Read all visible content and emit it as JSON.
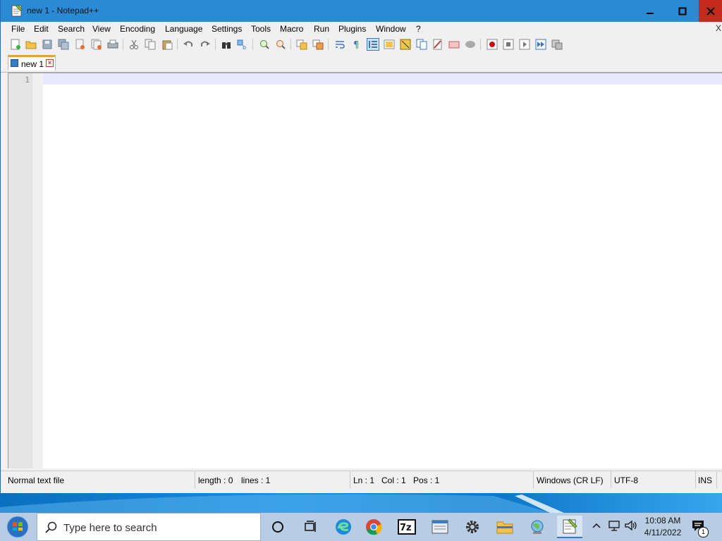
{
  "window": {
    "title": "new 1 - Notepad++",
    "controls": {
      "minimize": "minimize",
      "maximize": "maximize",
      "close": "close"
    }
  },
  "menubar": {
    "items": [
      "File",
      "Edit",
      "Search",
      "View",
      "Encoding",
      "Language",
      "Settings",
      "Tools",
      "Macro",
      "Run",
      "Plugins",
      "Window",
      "?"
    ],
    "close_glyph": "X"
  },
  "toolbar": {
    "buttons": [
      "new-file",
      "open-file",
      "save",
      "save-all",
      "close",
      "close-all",
      "print",
      "cut",
      "copy",
      "paste",
      "undo",
      "redo",
      "find",
      "replace",
      "zoom-in",
      "zoom-out",
      "sync-vertical",
      "sync-horizontal",
      "word-wrap",
      "show-all-characters",
      "indent-guide",
      "define-language",
      "document-map",
      "function-list",
      "folder-as-workspace",
      "monitoring",
      "start-recording",
      "stop-recording",
      "playback",
      "run-macro-multiple",
      "save-macro"
    ]
  },
  "tabs": [
    {
      "label": "new 1",
      "active": true
    }
  ],
  "editor": {
    "line_numbers": [
      "1"
    ],
    "content": ""
  },
  "statusbar": {
    "file_type": "Normal text file",
    "length": "length : 0",
    "lines": "lines : 1",
    "ln": "Ln : 1",
    "col": "Col : 1",
    "pos": "Pos : 1",
    "eol": "Windows (CR LF)",
    "encoding": "UTF-8",
    "mode": "INS"
  },
  "taskbar": {
    "search_placeholder": "Type here to search",
    "apps": [
      "cortana",
      "task-view",
      "edge",
      "chrome",
      "7-zip",
      "app-window",
      "settings",
      "file-explorer",
      "network",
      "notepad-plus-plus"
    ],
    "active_app": "notepad-plus-plus",
    "clock": {
      "time": "10:08 AM",
      "date": "4/11/2022"
    },
    "notification_count": "1"
  },
  "colors": {
    "titlebar": "#2a8ad4",
    "close": "#c42b1c",
    "current_line": "#e8e8ff",
    "tab_accent": "#f0a030"
  }
}
